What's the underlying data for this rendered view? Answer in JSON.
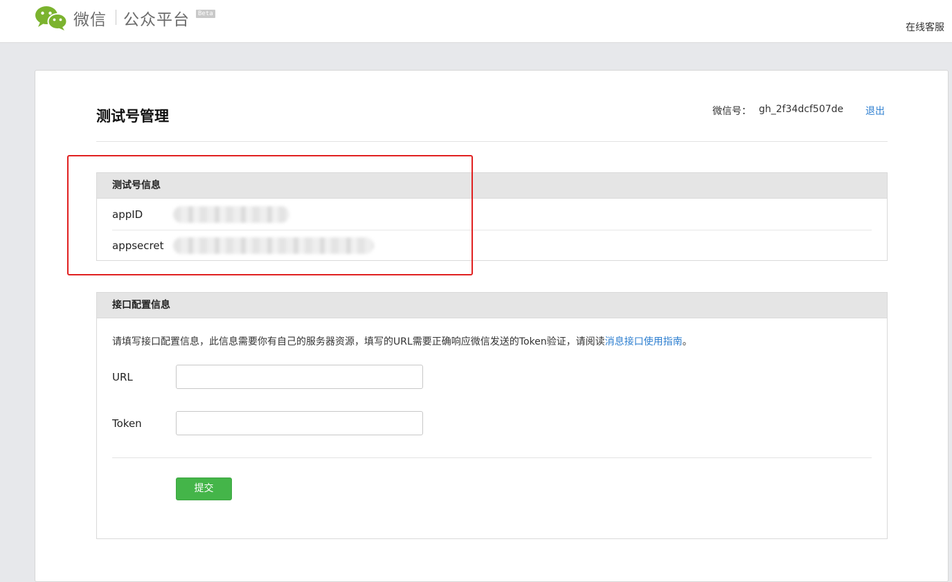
{
  "header": {
    "brand": "微信",
    "platform": "公众平台",
    "badge": "Beta",
    "online_service": "在线客服"
  },
  "page": {
    "title": "测试号管理",
    "account_label": "微信号：",
    "account_id": "gh_2f34dcf507de",
    "logout": "退出"
  },
  "test_account_info": {
    "title": "测试号信息",
    "rows": [
      {
        "key": "appID"
      },
      {
        "key": "appsecret"
      }
    ]
  },
  "interface_config": {
    "title": "接口配置信息",
    "description": "请填写接口配置信息，此信息需要你有自己的服务器资源，填写的URL需要正确响应微信发送的Token验证，请阅读",
    "guide_link": "消息接口使用指南",
    "period": "。",
    "url_label": "URL",
    "url_value": "",
    "token_label": "Token",
    "token_value": "",
    "submit": "提交"
  },
  "colors": {
    "accent_green": "#44b549",
    "link_blue": "#2e7fd0",
    "highlight_red": "#e02020"
  },
  "icons": {
    "logo": "wechat-logo-icon"
  }
}
